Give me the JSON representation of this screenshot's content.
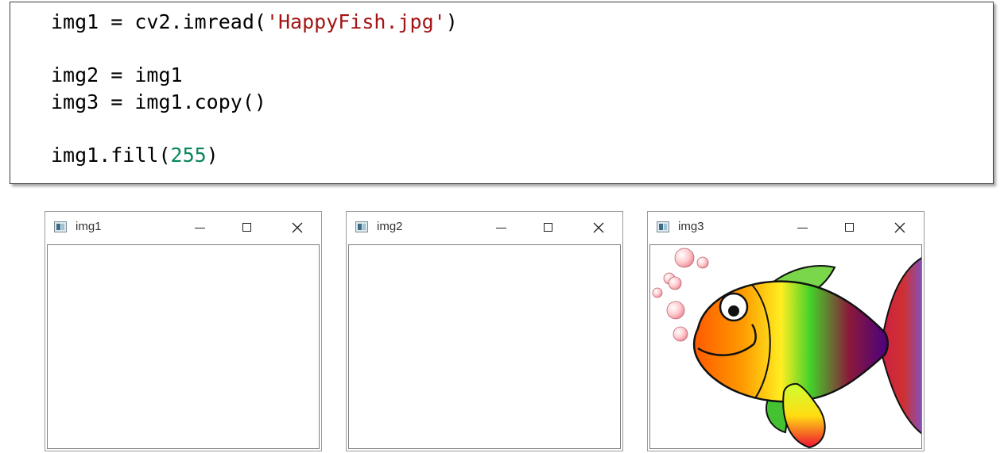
{
  "code": {
    "line1": {
      "a": "img1 = cv2.imread(",
      "str": "'HappyFish.jpg'",
      "b": ")"
    },
    "line2": "img2 = img1",
    "line3": "img3 = img1.copy()",
    "line4": {
      "a": "img1.fill(",
      "num": "255",
      "b": ")"
    }
  },
  "windows": [
    {
      "title": "img1"
    },
    {
      "title": "img2"
    },
    {
      "title": "img3"
    }
  ],
  "icons": {
    "app": "window-app-icon",
    "minimize": "minimize-icon",
    "maximize": "maximize-icon",
    "close": "close-icon"
  },
  "colors": {
    "string": "#a31515",
    "number": "#098658"
  }
}
